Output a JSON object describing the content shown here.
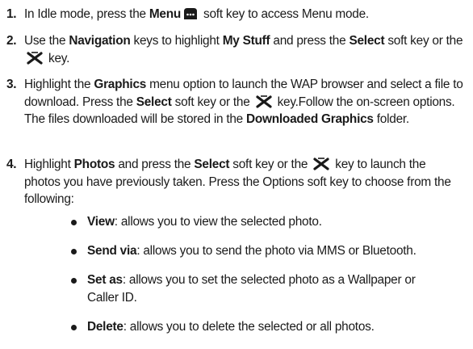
{
  "steps": [
    {
      "num": "1.",
      "parts": [
        "In Idle mode, press the ",
        "Menu",
        " soft key to access Menu mode."
      ],
      "icons": [
        "menu-softkey-icon"
      ]
    },
    {
      "num": "2.",
      "parts": [
        "Use the ",
        "Navigation",
        " keys to highlight ",
        "My Stuff",
        " and press the ",
        "Select",
        " soft key or the ",
        " key."
      ],
      "icons": [
        "select-key-icon"
      ]
    },
    {
      "num": "3.",
      "parts": [
        "Highlight the ",
        "Graphics",
        " menu option to launch the WAP browser and select a file to download. Press the ",
        "Select",
        " soft key or the ",
        " key.Follow the on-screen options. The files downloaded will be stored in the ",
        "Downloaded Graphics",
        " folder."
      ],
      "icons": [
        "select-key-icon"
      ]
    },
    {
      "num": "4.",
      "parts": [
        "Highlight ",
        "Photos",
        " and press the ",
        "Select",
        " soft key or the ",
        " key to launch the photos you have previously taken. Press the Options soft key to choose from the following:"
      ],
      "icons": [
        "select-key-icon"
      ]
    }
  ],
  "bullets": [
    {
      "term": "View",
      "text": ": allows you to view the selected photo."
    },
    {
      "term": "Send via",
      "text": ": allows you to send the photo via MMS or Bluetooth."
    },
    {
      "term": "Set as",
      "text": ": allows you to set the selected photo as a Wallpaper or Caller ID."
    },
    {
      "term": "Delete",
      "text": ": allows you to delete the selected or all photos."
    }
  ]
}
